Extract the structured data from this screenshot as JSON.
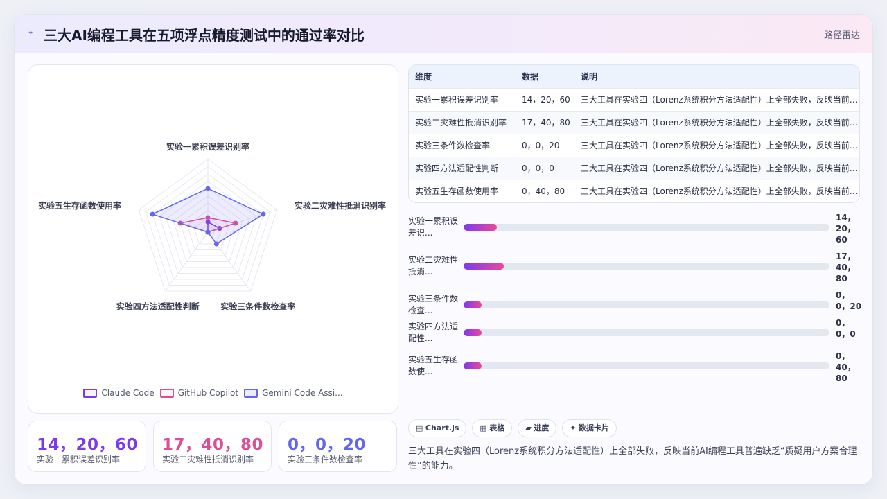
{
  "header": {
    "icon": "chart-icon",
    "title": "三大AI编程工具在五项浮点精度测试中的通过率对比",
    "link": "路径雷达"
  },
  "chart_data": {
    "type": "radar",
    "axes": [
      "实验一累积误差识别率",
      "实验二灾难性抵消识别率",
      "实验三条件数检查率",
      "实验四方法适配性判断",
      "实验五生存函数使用率"
    ],
    "series": [
      {
        "name": "Claude Code",
        "values": [
          14,
          17,
          0,
          0,
          0
        ],
        "color": "#7c3aed"
      },
      {
        "name": "GitHub Copilot",
        "values": [
          20,
          40,
          0,
          0,
          40
        ],
        "color": "#db4f96"
      },
      {
        "name": "Gemini Code Assi...",
        "values": [
          60,
          80,
          20,
          0,
          80
        ],
        "color": "#6366f1"
      }
    ],
    "rmax": 100,
    "grid": true,
    "legend": "bottom"
  },
  "stats": [
    {
      "value": "14，20，60",
      "label": "实验一累积误差识别率",
      "color": "#7c3aed"
    },
    {
      "value": "17，40，80",
      "label": "实验二灾难性抵消识别率",
      "color": "#db4f96"
    },
    {
      "value": "0，0，20",
      "label": "实验三条件数检查率",
      "color": "#6366f1"
    }
  ],
  "table": {
    "headers": [
      "维度",
      "数据",
      "说明"
    ],
    "rows": [
      [
        "实验一累积误差识别率",
        "14，20，60",
        "三大工具在实验四（Lorenz系统积分方法适配性）上全部失败，反映当前AI编程工具普遍缺乏“质疑用户方案合理性”的能力。"
      ],
      [
        "实验二灾难性抵消识别率",
        "17，40，80",
        "三大工具在实验四（Lorenz系统积分方法适配性）上全部失败，反映当前AI编程工具普遍缺乏“质疑用户方案合理性”的能力。"
      ],
      [
        "实验三条件数检查率",
        "0，0，20",
        "三大工具在实验四（Lorenz系统积分方法适配性）上全部失败，反映当前AI编程工具普遍缺乏“质疑用户方案合理性”的能力。"
      ],
      [
        "实验四方法适配性判断",
        "0，0，0",
        "三大工具在实验四（Lorenz系统积分方法适配性）上全部失败，反映当前AI编程工具普遍缺乏“质疑用户方案合理性”的能力。"
      ],
      [
        "实验五生存函数使用率",
        "0，40，80",
        "三大工具在实验四（Lorenz系统积分方法适配性）上全部失败，反映当前AI编程工具普遍缺乏“质疑用户方案合理性”的能力。"
      ]
    ]
  },
  "progress": [
    {
      "label": "实验一累积误差识...",
      "value_lines": [
        "14，",
        "20，",
        "60"
      ],
      "fill": 0.09
    },
    {
      "label": "实验二灾难性抵消...",
      "value_lines": [
        "17，",
        "40，",
        "80"
      ],
      "fill": 0.11
    },
    {
      "label": "实验三条件数检查...",
      "value_lines": [
        "0，",
        "0，20"
      ],
      "fill": 0.05
    },
    {
      "label": "实验四方法适配性...",
      "value_lines": [
        "0，",
        "0，0"
      ],
      "fill": 0.05
    },
    {
      "label": "实验五生存函数使...",
      "value_lines": [
        "0，",
        "40，",
        "80"
      ],
      "fill": 0.05
    }
  ],
  "chips": [
    {
      "icon": "chart-icon",
      "glyph": "▤",
      "label": "Chart.js"
    },
    {
      "icon": "table-icon",
      "glyph": "▦",
      "label": "表格"
    },
    {
      "icon": "progress-icon",
      "glyph": "▰",
      "label": "进度"
    },
    {
      "icon": "card-icon",
      "glyph": "✦",
      "label": "数据卡片"
    }
  ],
  "note": "三大工具在实验四（Lorenz系统积分方法适配性）上全部失败，反映当前AI编程工具普遍缺乏“质疑用户方案合理性”的能力。"
}
